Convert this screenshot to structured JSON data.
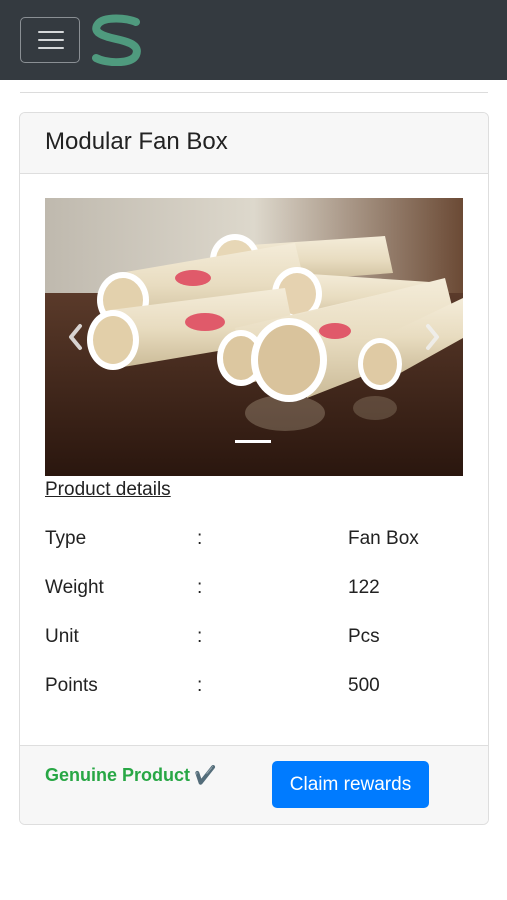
{
  "navbar": {
    "background": "#343a40",
    "toggler_icon": "hamburger-icon",
    "logo_icon": "s-logo-icon",
    "logo_color": "#4f9a7e"
  },
  "card": {
    "title": "Modular Fan Box",
    "carousel": {
      "image": "product-photo-pvc-pipes",
      "prev_icon": "chevron-left-icon",
      "next_icon": "chevron-right-icon",
      "active_slide": 1
    },
    "details_link": "Product details",
    "details": [
      {
        "label": "Type",
        "sep": ":",
        "value": "Fan Box"
      },
      {
        "label": "Weight",
        "sep": ":",
        "value": "122"
      },
      {
        "label": "Unit",
        "sep": ":",
        "value": "Pcs"
      },
      {
        "label": "Points",
        "sep": ":",
        "value": "500"
      }
    ],
    "footer": {
      "genuine_text": "Genuine Product",
      "genuine_check": "✔️",
      "genuine_color": "#28a745",
      "claim_button": "Claim rewards",
      "claim_color": "#007bff"
    }
  }
}
